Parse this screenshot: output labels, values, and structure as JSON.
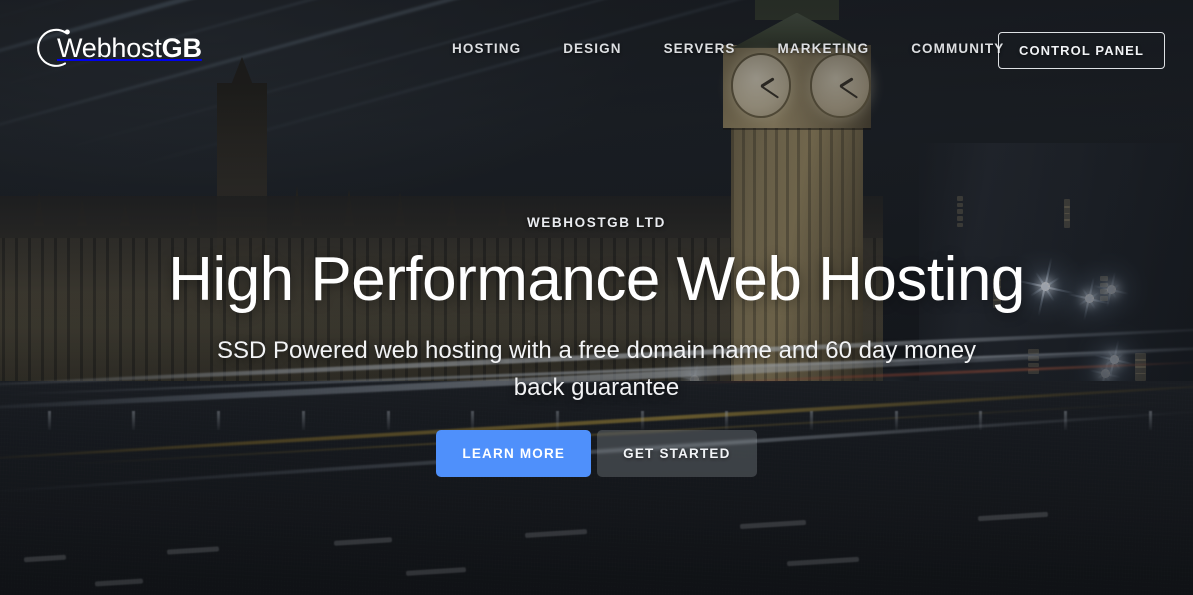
{
  "site": {
    "brand_prefix": "Webhost",
    "brand_suffix": "GB",
    "logo_mark_name": "circle-arc-dot-icon"
  },
  "header": {
    "nav": [
      {
        "label": "HOSTING",
        "name": "nav-item-hosting"
      },
      {
        "label": "DESIGN",
        "name": "nav-item-design"
      },
      {
        "label": "SERVERS",
        "name": "nav-item-servers"
      },
      {
        "label": "MARKETING",
        "name": "nav-item-marketing"
      },
      {
        "label": "COMMUNITY",
        "name": "nav-item-community"
      }
    ],
    "control_panel_label": "CONTROL PANEL"
  },
  "hero": {
    "eyebrow": "WEBHOSTGB LTD",
    "headline": "High Performance Web Hosting",
    "subhead": "SSD Powered web hosting with a free domain name and 60 day money back guarantee",
    "primary_cta": "LEARN MORE",
    "secondary_cta": "GET STARTED"
  },
  "colors": {
    "primary_button": "#4f90fb",
    "nav_text": "#dcdee1",
    "hero_text": "#ffffff",
    "background_dark": "#1b1f24"
  },
  "background": {
    "scene": "london-night-bigben-light-trails"
  }
}
